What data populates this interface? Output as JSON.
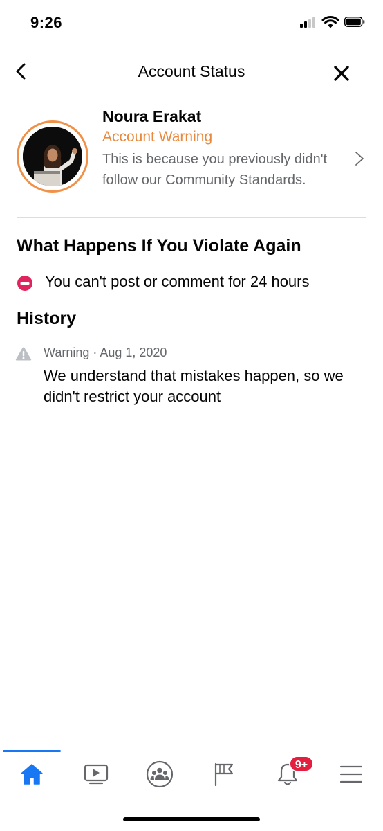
{
  "status_bar": {
    "time": "9:26"
  },
  "header": {
    "title": "Account Status"
  },
  "profile": {
    "name": "Noura Erakat",
    "status": "Account Warning",
    "description": "This is because you previously didn't follow our Community Standards."
  },
  "violate_section": {
    "title": "What Happens If You Violate Again",
    "rule": "You can't post or comment for 24 hours"
  },
  "history": {
    "title": "History",
    "items": [
      {
        "meta": "Warning · Aug 1, 2020",
        "text": "We understand that mistakes happen, so we didn't restrict your account"
      }
    ]
  },
  "tab_bar": {
    "tabs": [
      {
        "icon": "home-icon",
        "active": true
      },
      {
        "icon": "watch-icon",
        "active": false
      },
      {
        "icon": "groups-icon",
        "active": false
      },
      {
        "icon": "pages-flag-icon",
        "active": false
      },
      {
        "icon": "notifications-bell-icon",
        "active": false
      },
      {
        "icon": "menu-icon",
        "active": false
      }
    ],
    "notification_badge": "9+"
  },
  "colors": {
    "accent": "#1877f2",
    "warning_orange": "#e9893d",
    "badge_red": "#e41e3f",
    "secondary_text": "#65676b"
  }
}
